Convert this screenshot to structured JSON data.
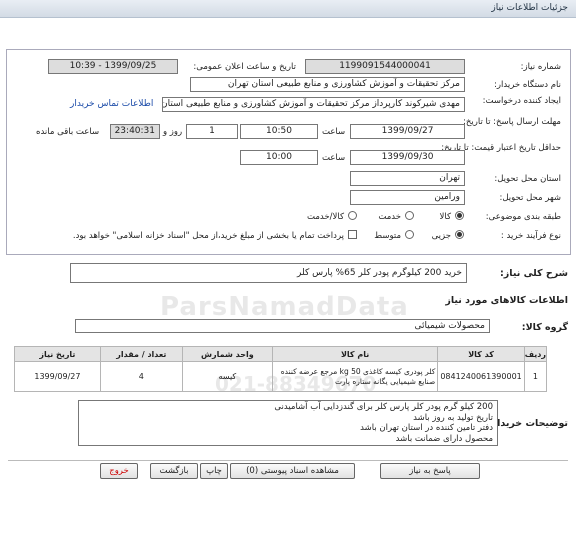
{
  "header": {
    "title": "جزئیات اطلاعات نیاز"
  },
  "need_number": {
    "label": "شماره نیاز:",
    "value": "1199091544000041"
  },
  "announce_date": {
    "label": "تاریخ و ساعت اعلان عمومی:",
    "value": "1399/09/25 - 10:39"
  },
  "buyer_org": {
    "label": "نام دستگاه خریدار:",
    "value": "مرکز تحقیقات و آموزش کشاورزی و منابع طبیعی استان تهران"
  },
  "creator": {
    "label": "ایجاد کننده درخواست:",
    "value": "مهدی شیرکوند کارپرداز مرکز تحقیقات و آموزش کشاورزی و منابع طبیعی استان تهران",
    "contact_link": "اطلاعات تماس خریدار"
  },
  "response_deadline": {
    "label": "مهلت ارسال پاسخ: تا تاریخ:",
    "date": "1399/09/27",
    "time_label": "ساعت",
    "time": "10:50",
    "days": "1",
    "days_label": "روز و",
    "remaining": "23:40:31",
    "remaining_label": "ساعت باقی مانده"
  },
  "price_validity": {
    "label": "حداقل تاریخ اعتبار قیمت: تا تاریخ:",
    "date": "1399/09/30",
    "time_label": "ساعت",
    "time": "10:00"
  },
  "delivery_province": {
    "label": "استان محل تحویل:",
    "value": "تهران"
  },
  "delivery_city": {
    "label": "شهر محل تحویل:",
    "value": "ورامین"
  },
  "category": {
    "label": "طبقه بندی موضوعی:",
    "options": [
      "کالا",
      "خدمت",
      "کالا/خدمت"
    ]
  },
  "purchase_process": {
    "label": "نوع فرآیند خرید :",
    "options": [
      "جزیی",
      "متوسط"
    ],
    "note": "پرداخت تمام یا بخشی از مبلغ خرید،از محل \"اسناد خزانه اسلامی\" خواهد بود."
  },
  "need_summary": {
    "label": "شرح کلی نیاز:",
    "value": "خرید 200 کیلوگرم پودر کلر 65% پارس کلر"
  },
  "goods_info": {
    "title": "اطلاعات کالاهای مورد نیاز"
  },
  "goods_group": {
    "label": "گروه کالا:",
    "value": "محصولات شیمیائی"
  },
  "table": {
    "headers": [
      "ردیف",
      "کد کالا",
      "نام کالا",
      "واحد شمارش",
      "تعداد / مقدار",
      "تاریخ نیاز"
    ],
    "rows": [
      [
        "1",
        "0841240061390001",
        "کلر پودری کیسه کاغذی kg 50 مرجع عرضه کننده صنایع شیمیایی یگانه ستاره پارت",
        "کیسه",
        "4",
        "1399/09/27"
      ]
    ]
  },
  "buyer_notes": {
    "label": "توضیحات خریدار:",
    "lines": [
      "200 کیلو گرم پودر کلر پارس کلر برای گندزدایی آب آشامیدنی",
      "تاریخ تولید به روز باشد",
      "دفتر تامین کننده در استان تهران باشد",
      "محصول دارای ضمانت باشد"
    ]
  },
  "buttons": {
    "reply": "پاسخ به نیاز",
    "attachments": "مشاهده اسناد پیوستی (0)",
    "print": "چاپ",
    "back": "بازگشت",
    "exit": "خروج"
  },
  "watermark": {
    "text": "ParsNamadData",
    "phone": "021-88349670"
  }
}
